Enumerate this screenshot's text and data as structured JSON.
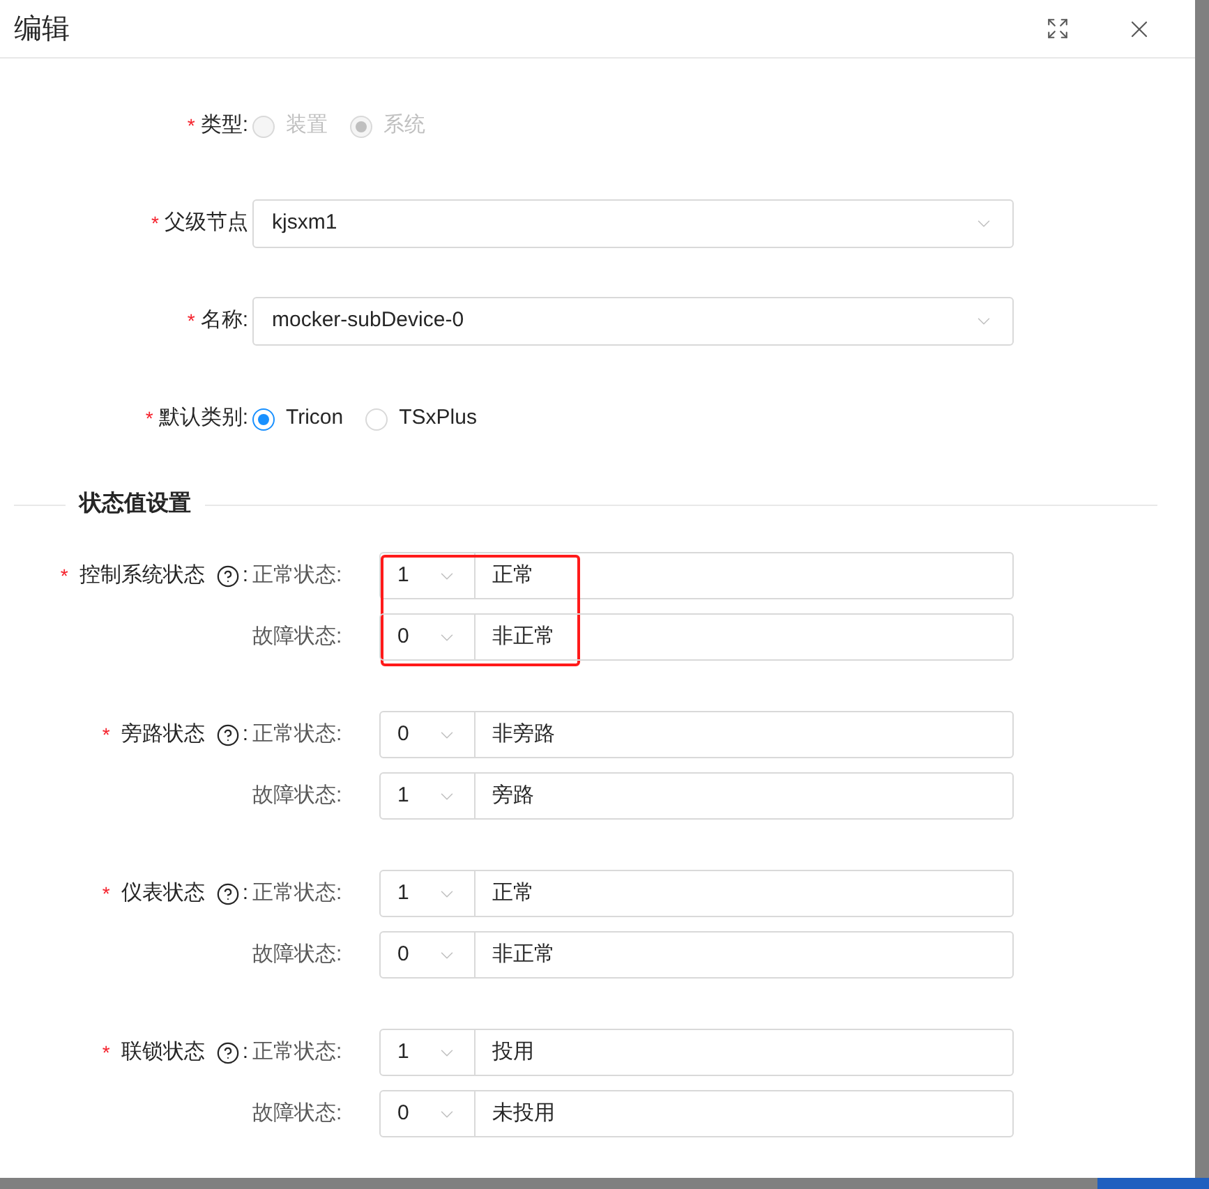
{
  "dialog": {
    "title": "编辑"
  },
  "form": [
    {
      "kind": "radio",
      "required_mark": "*",
      "label": "类型:",
      "disabled": true,
      "options": [
        {
          "label": "装置",
          "selected": false
        },
        {
          "label": "系统",
          "selected": true
        }
      ]
    },
    {
      "kind": "select",
      "required_mark": "*",
      "label": "父级节点",
      "value": "kjsxm1"
    },
    {
      "kind": "select",
      "required_mark": "*",
      "label": "名称:",
      "value": "mocker-subDevice-0"
    },
    {
      "kind": "radio",
      "required_mark": "*",
      "label": "默认类别:",
      "disabled": false,
      "options": [
        {
          "label": "Tricon",
          "selected": true
        },
        {
          "label": "TSxPlus",
          "selected": false
        }
      ]
    }
  ],
  "section": {
    "title": "状态值设置"
  },
  "status_groups": [
    {
      "required_mark": "*",
      "label": "控制系统状态",
      "colon": ":",
      "highlighted": true,
      "rows": [
        {
          "label": "正常状态:",
          "code": "1",
          "text": "正常"
        },
        {
          "label": "故障状态:",
          "code": "0",
          "text": "非正常"
        }
      ]
    },
    {
      "required_mark": "*",
      "label": "旁路状态",
      "colon": ":",
      "highlighted": false,
      "rows": [
        {
          "label": "正常状态:",
          "code": "0",
          "text": "非旁路"
        },
        {
          "label": "故障状态:",
          "code": "1",
          "text": "旁路"
        }
      ]
    },
    {
      "required_mark": "*",
      "label": "仪表状态",
      "colon": ":",
      "highlighted": false,
      "rows": [
        {
          "label": "正常状态:",
          "code": "1",
          "text": "正常"
        },
        {
          "label": "故障状态:",
          "code": "0",
          "text": "非正常"
        }
      ]
    },
    {
      "required_mark": "*",
      "label": "联锁状态",
      "colon": ":",
      "highlighted": false,
      "rows": [
        {
          "label": "正常状态:",
          "code": "1",
          "text": "投用"
        },
        {
          "label": "故障状态:",
          "code": "0",
          "text": "未投用"
        }
      ]
    }
  ]
}
